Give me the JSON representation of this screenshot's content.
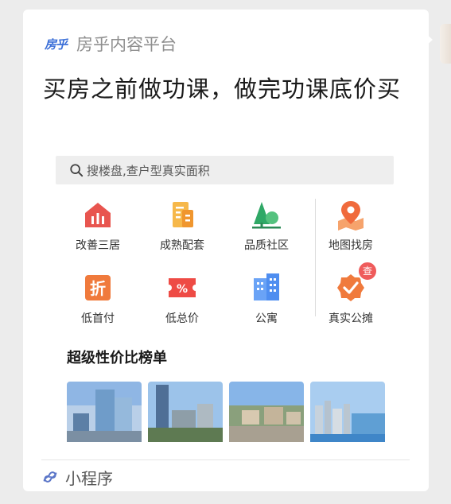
{
  "message": {
    "brand": {
      "logo_text": "房乎",
      "name": "房乎内容平台"
    },
    "headline": "买房之前做功课，做完功课底价买",
    "search": {
      "placeholder": "搜楼盘,查户型真实面积",
      "icon": "search-icon"
    },
    "categories": [
      {
        "label": "改善三居",
        "icon": "house-icon",
        "color": "#e8554f"
      },
      {
        "label": "成熟配套",
        "icon": "building-doc-icon",
        "color": "#f2a23a"
      },
      {
        "label": "品质社区",
        "icon": "tree-icon",
        "color": "#3bb36a"
      },
      {
        "label": "地图找房",
        "icon": "map-pin-icon",
        "color": "#f0774a"
      },
      {
        "label": "低首付",
        "icon": "discount-tag-icon",
        "color": "#f07a3c"
      },
      {
        "label": "低总价",
        "icon": "percent-ticket-icon",
        "color": "#ee4b45"
      },
      {
        "label": "公寓",
        "icon": "apartment-icon",
        "color": "#4f8ef0"
      },
      {
        "label": "真实公摊",
        "icon": "verified-badge-icon",
        "color": "#f07a3c",
        "badge": "查"
      }
    ],
    "ranking_title": "超级性价比榜单",
    "thumbnails": [
      {
        "icon": "city-photo-1"
      },
      {
        "icon": "city-photo-2"
      },
      {
        "icon": "city-photo-3"
      },
      {
        "icon": "city-photo-4"
      }
    ],
    "footer": {
      "label": "小程序",
      "icon": "mini-program-icon"
    }
  }
}
